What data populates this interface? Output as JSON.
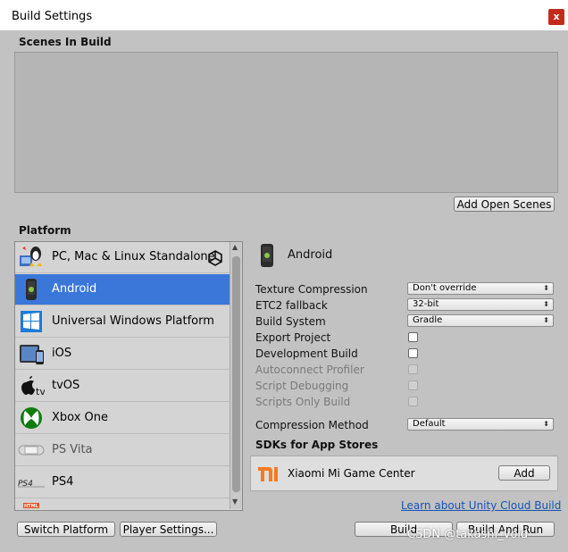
{
  "window": {
    "title": "Build Settings",
    "close_glyph": "x"
  },
  "scenes": {
    "label": "Scenes In Build",
    "add_open_scenes": "Add Open Scenes"
  },
  "platform": {
    "label": "Platform",
    "selected": "Android",
    "items": [
      {
        "label": "PC, Mac & Linux Standalone",
        "icon": "pc-mac-linux-icon"
      },
      {
        "label": "Android",
        "icon": "android-icon"
      },
      {
        "label": "Universal Windows Platform",
        "icon": "windows-icon"
      },
      {
        "label": "iOS",
        "icon": "ios-icon"
      },
      {
        "label": "tvOS",
        "icon": "appletv-icon"
      },
      {
        "label": "Xbox One",
        "icon": "xbox-icon"
      },
      {
        "label": "PS Vita",
        "icon": "psvita-icon"
      },
      {
        "label": "PS4",
        "icon": "ps4-icon"
      },
      {
        "label": "",
        "icon": "html5-icon"
      }
    ],
    "current_unity_icon": "unity-logo-icon"
  },
  "settings": {
    "header": "Android",
    "texture_compression": {
      "label": "Texture Compression",
      "value": "Don't override"
    },
    "etc2_fallback": {
      "label": "ETC2 fallback",
      "value": "32-bit"
    },
    "build_system": {
      "label": "Build System",
      "value": "Gradle"
    },
    "export_project": {
      "label": "Export Project",
      "checked": false
    },
    "development_build": {
      "label": "Development Build",
      "checked": false
    },
    "autoconnect_profiler": {
      "label": "Autoconnect Profiler",
      "checked": false,
      "disabled": true
    },
    "script_debugging": {
      "label": "Script Debugging",
      "checked": false,
      "disabled": true
    },
    "scripts_only_build": {
      "label": "Scripts Only Build",
      "checked": false,
      "disabled": true
    },
    "compression_method": {
      "label": "Compression Method",
      "value": "Default"
    }
  },
  "sdks": {
    "label": "SDKs for App Stores",
    "items": [
      {
        "name": "Xiaomi Mi Game Center",
        "icon": "xiaomi-icon",
        "button": "Add"
      }
    ]
  },
  "cloud_build_link": "Learn about Unity Cloud Build",
  "buttons": {
    "switch_platform": "Switch Platform",
    "player_settings": "Player Settings...",
    "build": "Build",
    "build_and_run": "Build And Run"
  },
  "watermark": "CSDN @takashi_void",
  "colors": {
    "selection": "#3a77d9",
    "link": "#1553b5",
    "close": "#c42b1c",
    "background": "#c2c2c2"
  }
}
